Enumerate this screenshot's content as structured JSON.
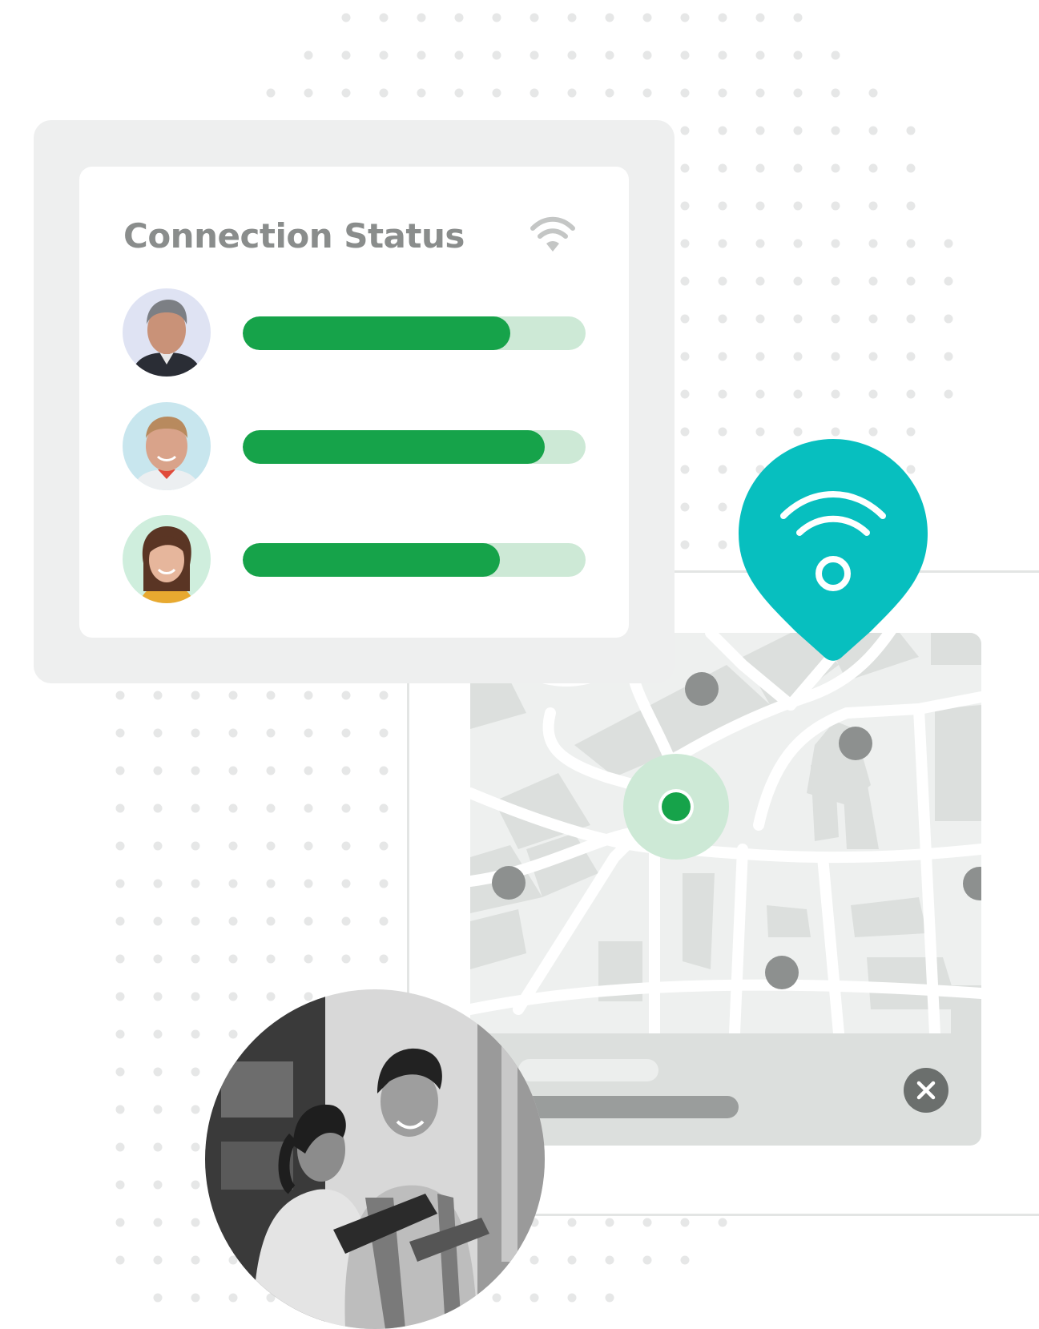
{
  "status_card": {
    "title": "Connection Status",
    "title_icon": "wifi-icon",
    "rows": [
      {
        "avatar": "man-gray-hair-avatar",
        "signal_fraction": 0.78
      },
      {
        "avatar": "man-smiling-avatar",
        "signal_fraction": 0.88
      },
      {
        "avatar": "woman-smiling-avatar",
        "signal_fraction": 0.75
      }
    ]
  },
  "map": {
    "location_pin_icon": "wifi-location-pin-icon",
    "current_location_icon": "current-location-dot-icon",
    "close_icon": "close-icon"
  },
  "photo": {
    "description_icon": "workers-with-tablet-photo"
  },
  "colors": {
    "accent_green": "#16a34a",
    "track_green": "#cde9d6",
    "pin_teal": "#07bfbf",
    "title_gray": "#8a8d8c"
  }
}
